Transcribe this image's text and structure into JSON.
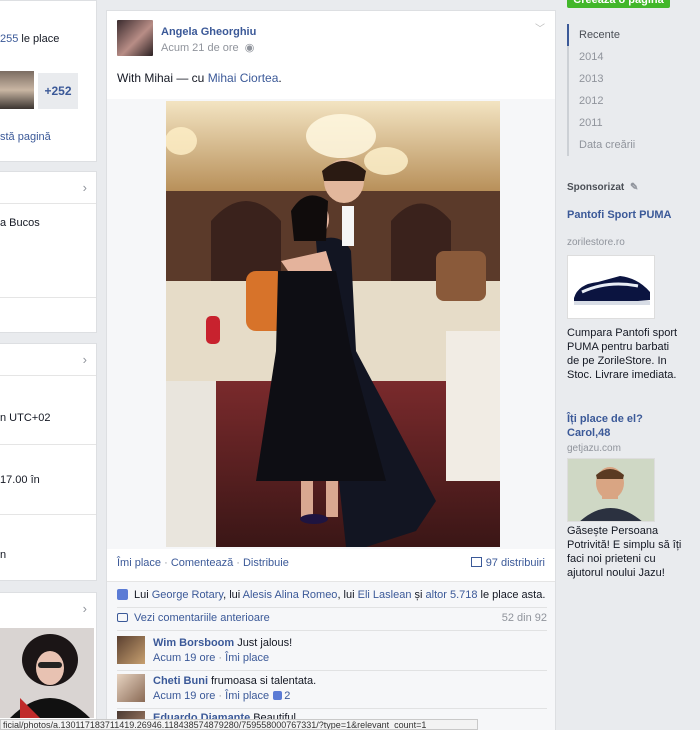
{
  "left": {
    "likes_count": "255",
    "likes_suffix": " le place",
    "friends_more": "+252",
    "page_link": "stă pagină",
    "about_text": "a Bucos",
    "tz_text": "n UTC+02",
    "hours_text": "17.00 în",
    "n_text": "n"
  },
  "post": {
    "author": "Angela Gheorghiu",
    "timestamp": "Acum 21 de ore",
    "caption_prefix": "With Mihai — cu ",
    "caption_tag": "Mihai Ciortea",
    "caption_suffix": ".",
    "actions": {
      "like": "Îmi place",
      "sep1": " · ",
      "comment": "Comentează",
      "sep2": " · ",
      "share": "Distribuie"
    },
    "shares": "97 distribuiri",
    "likes_summary": {
      "prefix": "Lui ",
      "p1": "George Rotary",
      "s1": ", lui ",
      "p2": "Alesis Alina Romeo",
      "s2": ", lui ",
      "p3": "Eli Laslean",
      "s3": " și ",
      "p4": "altor 5.718",
      "suffix": " le place asta."
    },
    "previous_comments": "Vezi comentariile anterioare",
    "comment_count": "52 din 92",
    "comments": [
      {
        "name": "Wim Borsboom",
        "text": "Just jalous!",
        "time": "Acum 19 ore",
        "like": "Îmi place",
        "likes": ""
      },
      {
        "name": "Cheti Buni",
        "text": "frumoasa si talentata.",
        "time": "Acum 19 ore",
        "like": "Îmi place",
        "likes": "2"
      },
      {
        "name": "Eduardo Diamante",
        "text": "Beautiful",
        "time": "",
        "like": "",
        "likes": ""
      }
    ]
  },
  "right": {
    "create_page": "Creează o pagină",
    "timeline": [
      "Recente",
      "2014",
      "2013",
      "2012",
      "2011",
      "Data creării"
    ],
    "sponsored": "Sponsorizat",
    "ads": [
      {
        "title": "Pantofi Sport PUMA",
        "domain": "zorilestore.ro",
        "desc": "Cumpara Pantofi sport PUMA pentru barbati de pe ZorileStore. In Stoc. Livrare imediata."
      },
      {
        "title": "Îți place de el? Carol,48",
        "domain": "getjazu.com",
        "desc": "Găsește Persoana Potrivită! E simplu să îți faci noi prieteni cu ajutorul noului Jazu!"
      }
    ]
  },
  "status_url": "ficial/photos/a.130117183711419.26946.118438574879280/759558000767331/?type=1&relevant_count=1"
}
